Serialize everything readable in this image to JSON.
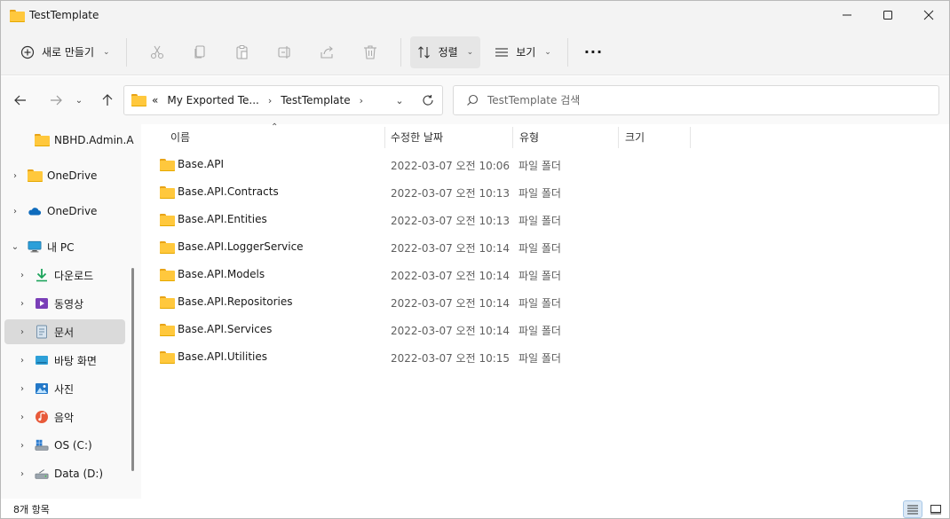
{
  "window": {
    "title": "TestTemplate"
  },
  "toolbar": {
    "new_label": "새로 만들기",
    "sort_label": "정렬",
    "view_label": "보기",
    "more_label": "···"
  },
  "address": {
    "overflow": "«",
    "crumbs": [
      "My Exported Te...",
      "TestTemplate"
    ]
  },
  "search": {
    "placeholder": "TestTemplate 검색"
  },
  "sidebar": {
    "items": [
      {
        "label": "NBHD.Admin.A",
        "icon": "folder-icon"
      },
      {
        "label": "OneDrive",
        "icon": "folder-icon"
      },
      {
        "label": "OneDrive",
        "icon": "cloud-icon"
      },
      {
        "label": "내 PC",
        "icon": "computer-icon"
      },
      {
        "label": "다운로드",
        "icon": "download-icon"
      },
      {
        "label": "동영상",
        "icon": "video-icon"
      },
      {
        "label": "문서",
        "icon": "document-icon"
      },
      {
        "label": "바탕 화면",
        "icon": "desktop-icon"
      },
      {
        "label": "사진",
        "icon": "pictures-icon"
      },
      {
        "label": "음악",
        "icon": "music-icon"
      },
      {
        "label": "OS (C:)",
        "icon": "drive-c-icon"
      },
      {
        "label": "Data (D:)",
        "icon": "drive-d-icon"
      }
    ]
  },
  "columns": {
    "name": "이름",
    "modified": "수정한 날짜",
    "type": "유형",
    "size": "크기"
  },
  "files": [
    {
      "name": "Base.API",
      "date": "2022-03-07 오전 10:06",
      "type": "파일 폴더"
    },
    {
      "name": "Base.API.Contracts",
      "date": "2022-03-07 오전 10:13",
      "type": "파일 폴더"
    },
    {
      "name": "Base.API.Entities",
      "date": "2022-03-07 오전 10:13",
      "type": "파일 폴더"
    },
    {
      "name": "Base.API.LoggerService",
      "date": "2022-03-07 오전 10:14",
      "type": "파일 폴더"
    },
    {
      "name": "Base.API.Models",
      "date": "2022-03-07 오전 10:14",
      "type": "파일 폴더"
    },
    {
      "name": "Base.API.Repositories",
      "date": "2022-03-07 오전 10:14",
      "type": "파일 폴더"
    },
    {
      "name": "Base.API.Services",
      "date": "2022-03-07 오전 10:14",
      "type": "파일 폴더"
    },
    {
      "name": "Base.API.Utilities",
      "date": "2022-03-07 오전 10:15",
      "type": "파일 폴더"
    }
  ],
  "status": {
    "count": "8개 항목"
  },
  "colors": {
    "folder": "#ffc83d",
    "selected": "#dadada",
    "accent": "#0067c0"
  }
}
